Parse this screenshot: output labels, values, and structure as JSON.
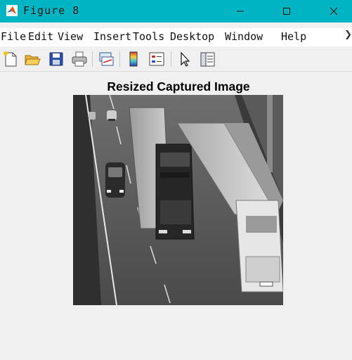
{
  "window": {
    "title": "Figure 8",
    "minimize_icon": "minimize-icon",
    "maximize_icon": "maximize-icon",
    "close_icon": "close-icon",
    "app_icon": "matlab-logo-icon"
  },
  "menubar": {
    "items": [
      "File",
      "Edit",
      "View",
      "Insert",
      "Tools",
      "Desktop",
      "Window",
      "Help"
    ],
    "overflow_icon": "chevron-right-icon"
  },
  "toolbar": {
    "buttons": [
      "new-figure-icon",
      "open-file-icon",
      "save-icon",
      "print-icon",
      "link-plot-icon",
      "insert-colorbar-icon",
      "insert-legend-icon",
      "pointer-icon",
      "property-inspector-icon"
    ]
  },
  "figure": {
    "title": "Resized Captured Image",
    "image_subject": "grayscale-traffic-camera-photo",
    "colors": {
      "title_bar": "#00b4c2",
      "background": "#f0f0f0"
    }
  }
}
